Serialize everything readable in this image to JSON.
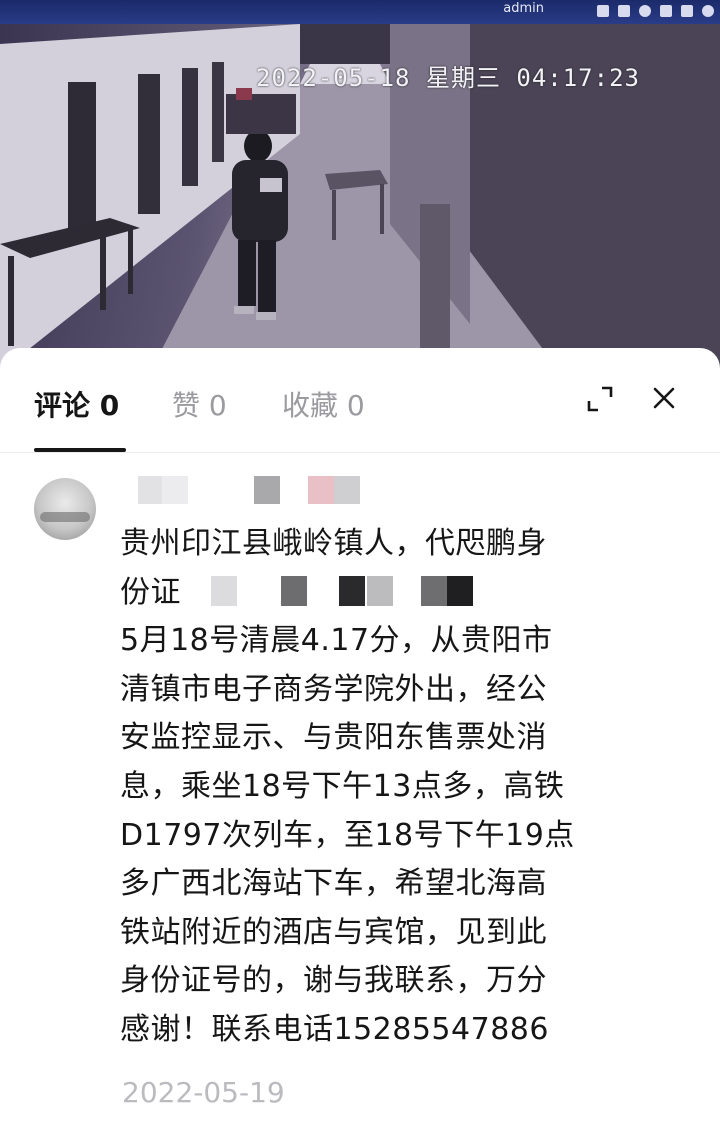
{
  "video": {
    "user": "admin",
    "timestamp": "2022-05-18 星期三 04:17:23"
  },
  "tabs": [
    {
      "label": "评论 0",
      "active": true
    },
    {
      "label": "赞 0",
      "active": false
    },
    {
      "label": "收藏 0",
      "active": false
    }
  ],
  "comment": {
    "lines": [
      "贵州印江县峨岭镇人，代咫鹏身",
      "份证",
      "5月18号清晨4.17分，从贵阳市",
      "清镇市电子商务学院外出，经公",
      "安监控显示、与贵阳东售票处消",
      "息，乘坐18号下午13点多，高铁",
      "D1797次列车，至18号下午19点",
      "多广西北海站下车，希望北海高",
      "铁站附近的酒店与宾馆，见到此",
      "身份证号的，谢与我联系，万分",
      "感谢！联系电话15285547886"
    ],
    "date": "2022-05-19"
  },
  "icons": {
    "expand": "expand-icon",
    "close": "close-icon"
  },
  "colors": {
    "text_primary": "#161616",
    "text_secondary": "#9a9a9f",
    "date": "#bbbbbf",
    "video_bar": "#1f2f78"
  }
}
